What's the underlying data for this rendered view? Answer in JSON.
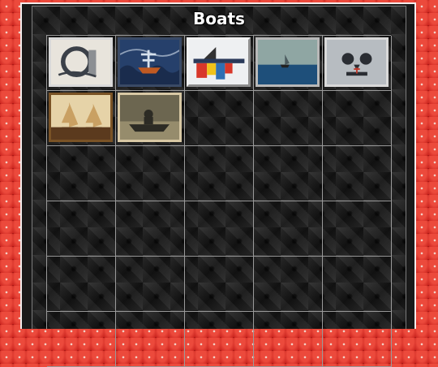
{
  "page": {
    "title": "Boats"
  },
  "gallery": {
    "columns": 5,
    "rows": 6,
    "items": [
      {
        "name": "surreal-boat-painting-thumbnail",
        "frame": "silver",
        "colors": [
          "#e8e4dc",
          "#3b4048",
          "#8c8f93"
        ]
      },
      {
        "name": "stormy-sea-ship-painting-thumbnail",
        "frame": "blue",
        "colors": [
          "#26406b",
          "#c05a22",
          "#d7e2ee"
        ]
      },
      {
        "name": "dripping-color-boat-painting-thumbnail",
        "frame": "bevel",
        "colors": [
          "#eef0f2",
          "#d8372a",
          "#f0c21a"
        ]
      },
      {
        "name": "lone-sailboat-painting-thumbnail",
        "frame": "gray",
        "colors": [
          "#8fa6a3",
          "#1e4f7a",
          "#4b5a5e"
        ]
      },
      {
        "name": "skull-clouds-ship-painting-thumbnail",
        "frame": "silver",
        "colors": [
          "#b7bcc1",
          "#2a2d33",
          "#c0392b"
        ]
      },
      {
        "name": "golden-sailboats-painting-thumbnail",
        "frame": "wood",
        "colors": [
          "#c9a063",
          "#5b3a1e",
          "#e6d3a8"
        ]
      },
      {
        "name": "figure-in-boat-painting-thumbnail",
        "frame": "cream",
        "colors": [
          "#6c6650",
          "#2c2b24",
          "#a89c78"
        ]
      }
    ]
  }
}
